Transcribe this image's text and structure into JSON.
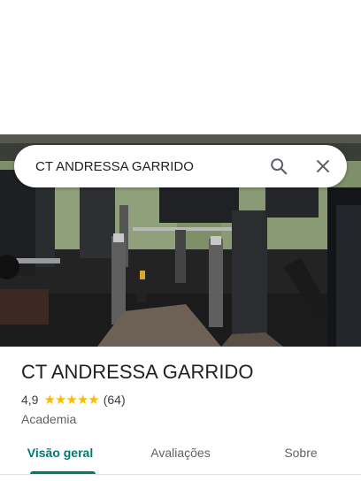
{
  "search": {
    "query": "CT ANDRESSA GARRIDO",
    "search_icon": "search-icon",
    "close_icon": "close-icon"
  },
  "hero": {
    "photo": "gym-equipment-photo"
  },
  "place": {
    "name": "CT ANDRESSA GARRIDO",
    "rating": "4,9",
    "stars_value": 4.9,
    "review_count": "(64)",
    "category": "Academia"
  },
  "tabs": [
    {
      "label": "Visão geral",
      "active": true
    },
    {
      "label": "Avaliações",
      "active": false
    },
    {
      "label": "Sobre",
      "active": false
    }
  ],
  "colors": {
    "accent": "#01796f",
    "star": "#fbbc04"
  }
}
